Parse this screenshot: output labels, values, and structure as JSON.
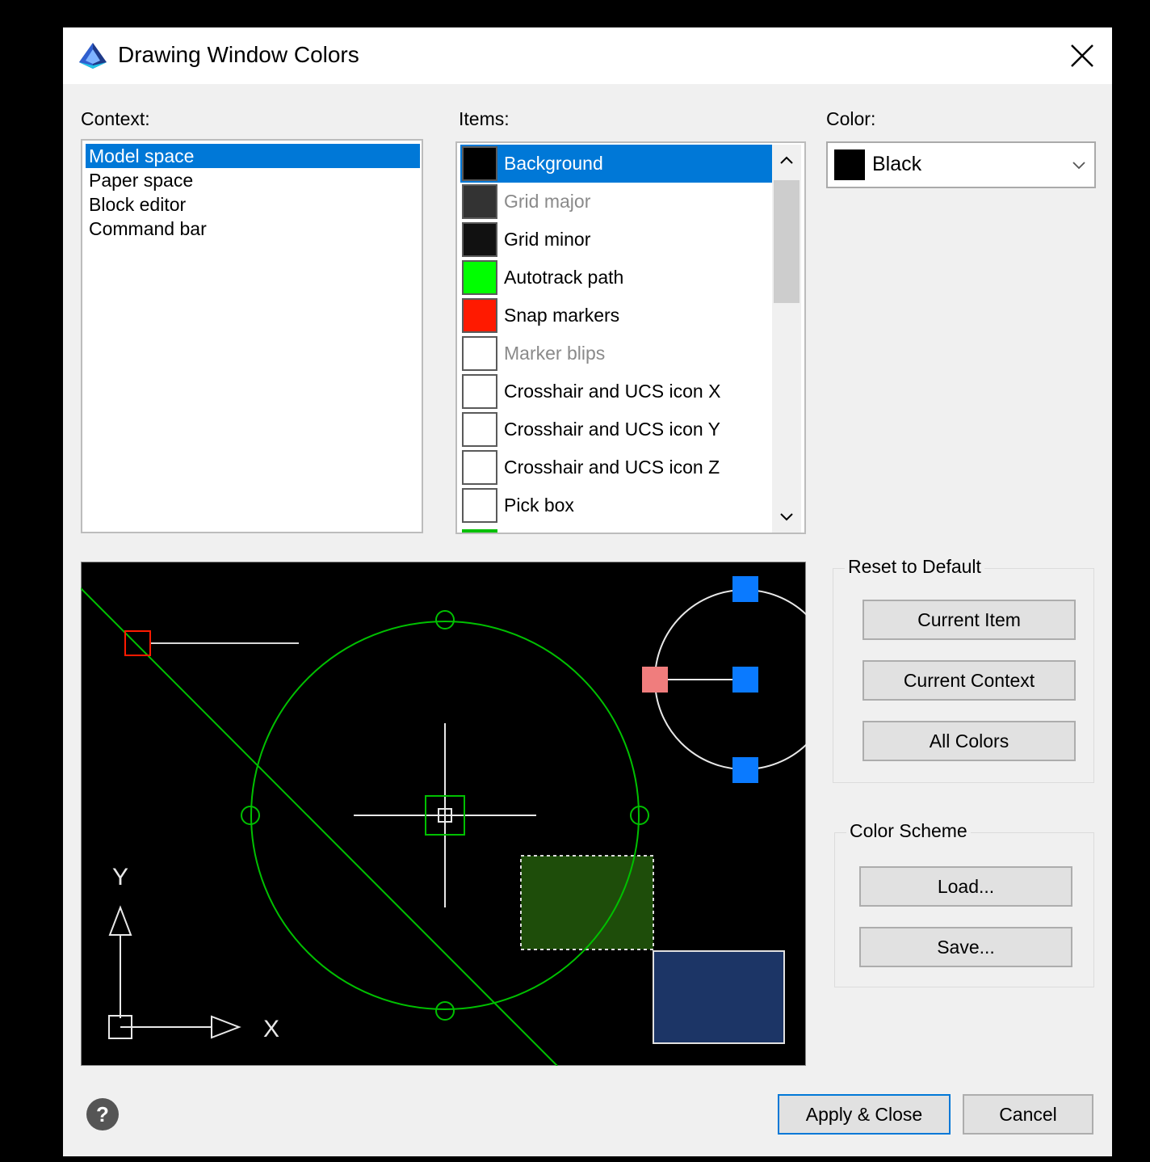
{
  "window": {
    "title": "Drawing Window Colors"
  },
  "context": {
    "label": "Context:",
    "items": [
      "Model space",
      "Paper space",
      "Block editor",
      "Command bar"
    ],
    "selected_index": 0
  },
  "items": {
    "label": "Items:",
    "selected_index": 0,
    "list": [
      {
        "label": "Background",
        "color": "#000000",
        "disabled": false
      },
      {
        "label": "Grid major",
        "color": "#333333",
        "disabled": true
      },
      {
        "label": "Grid minor",
        "color": "#111111",
        "disabled": false
      },
      {
        "label": "Autotrack path",
        "color": "#00ff00",
        "disabled": false
      },
      {
        "label": "Snap markers",
        "color": "#ff1a00",
        "disabled": false
      },
      {
        "label": "Marker blips",
        "color": "#ffffff",
        "disabled": true
      },
      {
        "label": "Crosshair and UCS icon X",
        "color": "#ffffff",
        "disabled": false
      },
      {
        "label": "Crosshair and UCS icon Y",
        "color": "#ffffff",
        "disabled": false
      },
      {
        "label": "Crosshair and UCS icon Z",
        "color": "#ffffff",
        "disabled": false
      },
      {
        "label": "Pick box",
        "color": "#ffffff",
        "disabled": false
      }
    ]
  },
  "color": {
    "label": "Color:",
    "value": "Black",
    "swatch": "#000000"
  },
  "preview": {
    "axis_x": "X",
    "axis_y": "Y"
  },
  "reset_group": {
    "title": "Reset to Default",
    "current_item": "Current Item",
    "current_context": "Current Context",
    "all_colors": "All Colors"
  },
  "scheme_group": {
    "title": "Color Scheme",
    "load": "Load...",
    "save": "Save..."
  },
  "footer": {
    "apply_close": "Apply & Close",
    "cancel": "Cancel"
  },
  "colors": {
    "accent": "#0078d7",
    "dialog_bg": "#f0f0f0"
  }
}
